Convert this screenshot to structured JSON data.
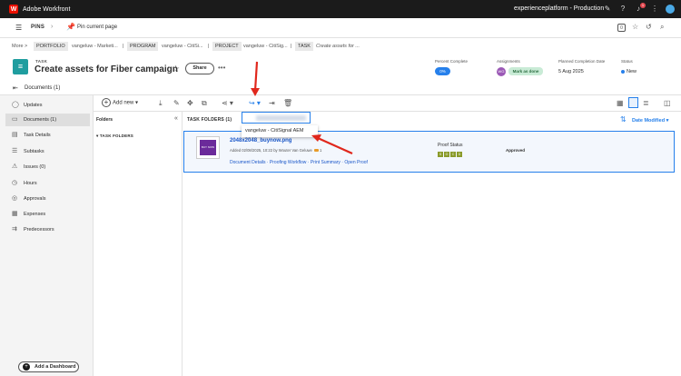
{
  "topbar": {
    "app_name": "Adobe Workfront",
    "logo_glyph": "W",
    "org": "experienceplatform - Production",
    "notification_count": "1"
  },
  "pins": {
    "label": "PINS",
    "pin_current": "Pin current page"
  },
  "breadcrumb": {
    "more": "More >",
    "portfolio_tag": "PORTFOLIO",
    "portfolio": "vangeluw - Marketi...",
    "program_tag": "PROGRAM",
    "program": "vangeluw - CitiSi...",
    "project_tag": "PROJECT",
    "project": "vangeluw - CitiSig...",
    "task_tag": "TASK",
    "task": "Create assets for ..."
  },
  "task": {
    "type": "TASK",
    "title": "Create assets for Fiber campaign",
    "share": "Share"
  },
  "meta": {
    "percent_label": "Percent Complete",
    "percent": "0%",
    "assign_label": "Assignments",
    "assignee_initials": "WG",
    "mark_done": "Mark as done",
    "planned_label": "Planned Completion Date",
    "planned": "5 Aug 2025",
    "status_label": "Status",
    "status": "New"
  },
  "docs_bar": {
    "label": "Documents (1)"
  },
  "sidebar": {
    "items": [
      {
        "label": "Updates"
      },
      {
        "label": "Documents (1)"
      },
      {
        "label": "Task Details"
      },
      {
        "label": "Subtasks"
      },
      {
        "label": "Issues (0)"
      },
      {
        "label": "Hours"
      },
      {
        "label": "Approvals"
      },
      {
        "label": "Expenses"
      },
      {
        "label": "Predecessors"
      }
    ],
    "add_dashboard": "Add a Dashboard"
  },
  "toolbar": {
    "add_new": "Add new"
  },
  "folders": {
    "header": "Folders",
    "task_folders": "TASK FOLDERS"
  },
  "main": {
    "header": "TASK FOLDERS (1)",
    "sort_label": "Date Modified"
  },
  "dropdown": {
    "option": "vangeluw - CitiSignal AEM"
  },
  "document": {
    "file_name": "2048x2048_buynow.png",
    "added": "Added 02/08/2025, 10:22 by Wouter Van Geluwe",
    "comments": "1",
    "link_details": "Document Details",
    "link_proofing": "Proofing Workflow",
    "link_print": "Print Summary",
    "link_open": "Open Proof",
    "proof_status_label": "Proof Status",
    "proof_letters": [
      "S",
      "O",
      "C",
      "D"
    ],
    "approval": "Approved",
    "thumb_text": "BUY NOW"
  }
}
